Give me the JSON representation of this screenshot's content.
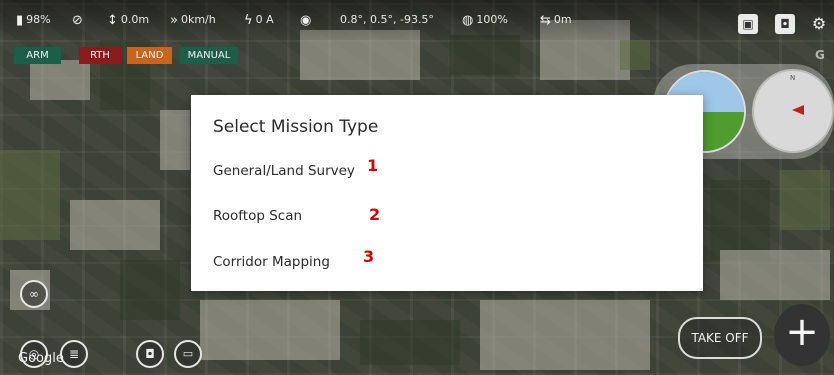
{
  "status_bar": {
    "battery": "98%",
    "altitude": "0.0m",
    "speed": "0km/h",
    "current": "0 A",
    "gimbal": "0.8°, 0.5°, -93.5°",
    "signal": "100%",
    "distance": "0m",
    "icons": [
      "battery-icon",
      "gps-off-icon",
      "altitude-icon",
      "speed-icon",
      "current-icon",
      "gimbal-icon",
      "signal-icon",
      "distance-icon",
      "save-icon",
      "camera-icon",
      "settings-icon"
    ]
  },
  "modes": {
    "arm": "ARM",
    "rth": "RTH",
    "land": "LAND",
    "manual": "MANUAL",
    "colors": {
      "arm": "#1b5e4a",
      "rth": "#8b1b1b",
      "land": "#c8641b",
      "manual": "#1b5e4a"
    }
  },
  "dialog": {
    "title": "Select Mission Type",
    "options": [
      {
        "label": "General/Land Survey",
        "number": "1"
      },
      {
        "label": "Rooftop Scan",
        "number": "2"
      },
      {
        "label": "Corridor Mapping",
        "number": "3"
      }
    ]
  },
  "compass": {
    "north_label": "N",
    "corner_label": "G"
  },
  "bottom": {
    "takeoff_label": "TAKE OFF",
    "plus_label": "+",
    "map_attribution": "Google"
  }
}
